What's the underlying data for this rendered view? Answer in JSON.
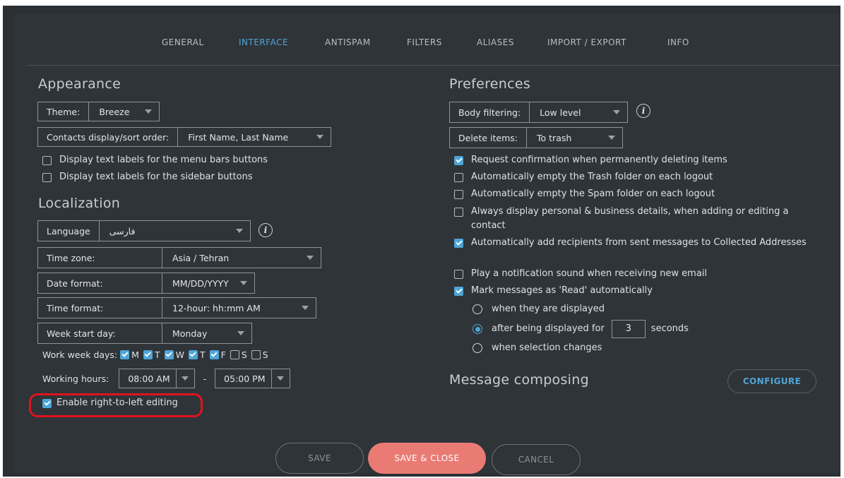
{
  "tabs": [
    {
      "label": "GENERAL"
    },
    {
      "label": "INTERFACE"
    },
    {
      "label": "ANTISPAM"
    },
    {
      "label": "FILTERS"
    },
    {
      "label": "ALIASES"
    },
    {
      "label": "IMPORT / EXPORT"
    },
    {
      "label": "INFO"
    }
  ],
  "active_tab": "INTERFACE",
  "appearance": {
    "title": "Appearance",
    "theme": {
      "label": "Theme:",
      "value": "Breeze"
    },
    "contacts_order": {
      "label": "Contacts display/sort order:",
      "value": "First Name, Last Name"
    },
    "checks": [
      {
        "label": "Display text labels for the menu bars buttons",
        "checked": false
      },
      {
        "label": "Display text labels for the sidebar buttons",
        "checked": false
      }
    ]
  },
  "localization": {
    "title": "Localization",
    "language": {
      "label": "Language",
      "value": "فارسی"
    },
    "timezone": {
      "label": "Time zone:",
      "value": "Asia / Tehran"
    },
    "date_format": {
      "label": "Date format:",
      "value": "MM/DD/YYYY"
    },
    "time_format": {
      "label": "Time format:",
      "value": "12-hour: hh:mm AM"
    },
    "week_start": {
      "label": "Week start day:",
      "value": "Monday"
    },
    "work_week": {
      "label": "Work week days:",
      "days": [
        {
          "label": "M",
          "checked": true
        },
        {
          "label": "T",
          "checked": true
        },
        {
          "label": "W",
          "checked": true
        },
        {
          "label": "T",
          "checked": true
        },
        {
          "label": "F",
          "checked": true
        },
        {
          "label": "S",
          "checked": false
        },
        {
          "label": "S",
          "checked": false
        }
      ]
    },
    "working_hours": {
      "label": "Working hours:",
      "start": "08:00 AM",
      "separator": "-",
      "end": "05:00 PM"
    },
    "rtl": {
      "label": "Enable right-to-left editing",
      "checked": true
    }
  },
  "preferences": {
    "title": "Preferences",
    "body_filtering": {
      "label": "Body filtering:",
      "value": "Low level"
    },
    "delete_items": {
      "label": "Delete items:",
      "value": "To trash"
    },
    "checks": [
      {
        "label": "Request confirmation when permanently deleting items",
        "checked": true
      },
      {
        "label": "Automatically empty the Trash folder on each logout",
        "checked": false
      },
      {
        "label": "Automatically empty the Spam folder on each logout",
        "checked": false
      },
      {
        "label": "Always display personal & business details, when adding or editing a contact",
        "checked": false
      },
      {
        "label": "Automatically add recipients from sent messages to Collected Addresses",
        "checked": true
      },
      {
        "label": "Play a notification sound when receiving new email",
        "checked": false
      },
      {
        "label": "Mark messages as 'Read' automatically",
        "checked": true
      }
    ],
    "read_options": [
      {
        "label": "when they are displayed",
        "selected": false
      },
      {
        "label": "after being displayed for",
        "selected": true,
        "seconds": "3",
        "suffix": "seconds"
      },
      {
        "label": "when selection changes",
        "selected": false
      }
    ]
  },
  "composing": {
    "title": "Message composing",
    "configure_label": "CONFIGURE"
  },
  "footer": {
    "save": "SAVE",
    "save_close": "SAVE & CLOSE",
    "cancel": "CANCEL"
  },
  "colors": {
    "accent": "#4fa5d8",
    "primary_button": "#e97b74",
    "highlight": "#e0131f",
    "background": "#2f3438"
  }
}
